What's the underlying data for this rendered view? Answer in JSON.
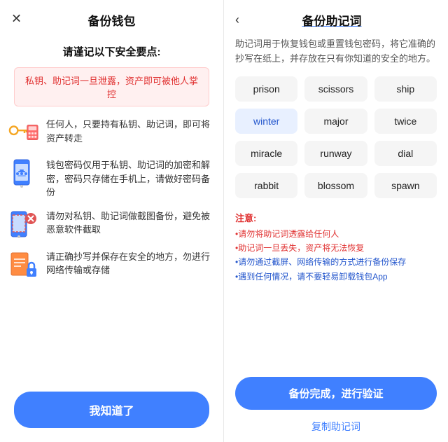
{
  "left": {
    "close_label": "✕",
    "title": "备份钱包",
    "subtitle": "请谨记以下安全要点:",
    "warning": "私钥、助记词一旦泄露，资产即可被他人掌控",
    "items": [
      {
        "icon": "key-wallet-icon",
        "text": "任何人，只要持有私钥、助记词，即可将资产转走"
      },
      {
        "icon": "phone-lock-icon",
        "text": "钱包密码仅用于私钥、助记词的加密和解密，密码只存储在手机上，请做好密码备份"
      },
      {
        "icon": "phone-scissors-icon",
        "text": "请勿对私钥、助记词做截图备份，避免被恶意软件截取"
      },
      {
        "icon": "note-safe-icon",
        "text": "请正确抄写并保存在安全的地方，勿进行网络传输或存储"
      }
    ],
    "button_label": "我知道了"
  },
  "right": {
    "back_label": "‹",
    "title": "备份助记词",
    "description": "助记词用于恢复钱包或重置钱包密码，将它准确的抄写在纸上，并存放在只有你知道的安全的地方。",
    "words": [
      {
        "text": "prison",
        "highlight": false
      },
      {
        "text": "scissors",
        "highlight": false
      },
      {
        "text": "ship",
        "highlight": false
      },
      {
        "text": "winter",
        "highlight": true
      },
      {
        "text": "major",
        "highlight": false
      },
      {
        "text": "twice",
        "highlight": false
      },
      {
        "text": "miracle",
        "highlight": false
      },
      {
        "text": "runway",
        "highlight": false
      },
      {
        "text": "dial",
        "highlight": false
      },
      {
        "text": "rabbit",
        "highlight": false
      },
      {
        "text": "blossom",
        "highlight": false
      },
      {
        "text": "spawn",
        "highlight": false
      }
    ],
    "notes_title": "注意:",
    "notes": [
      {
        "text": "请勿将助记词透露给任何人",
        "blue": false
      },
      {
        "text": "助记词一旦丢失，资产将无法恢复",
        "blue": false
      },
      {
        "text": "请勿通过截屏、网络传输的方式进行备份保存",
        "blue": true
      },
      {
        "text": "遇到任何情况，请不要轻易卸载钱包App",
        "blue": true
      }
    ],
    "complete_button": "备份完成，进行验证",
    "copy_button": "复制助记词"
  }
}
